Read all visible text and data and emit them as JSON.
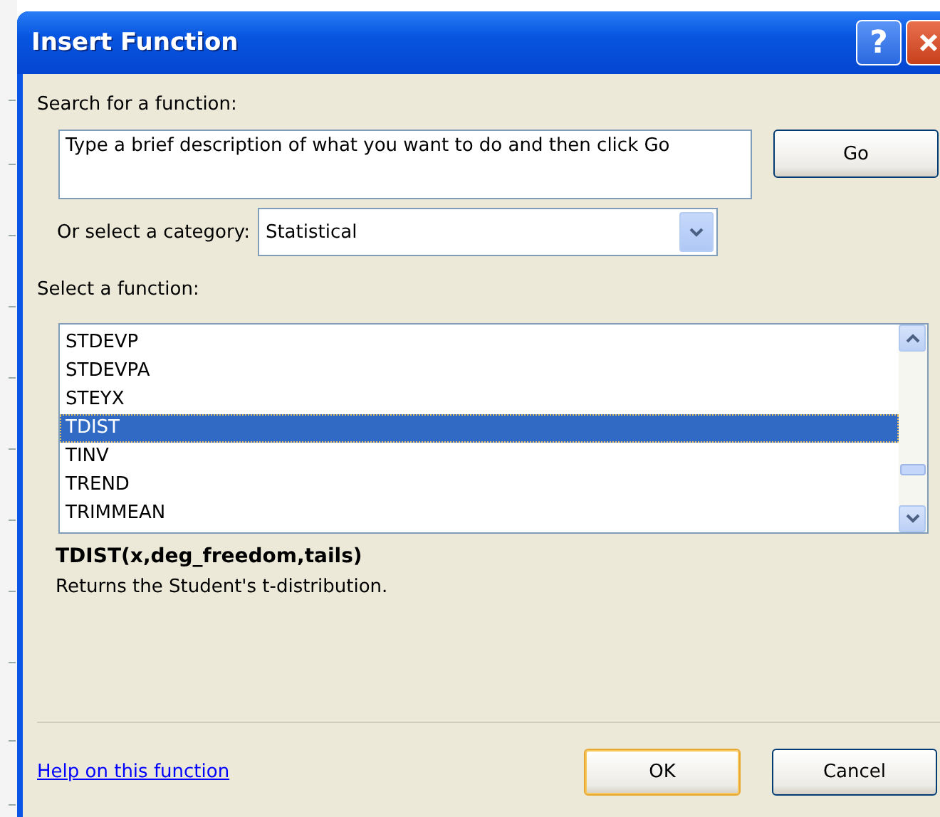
{
  "window": {
    "title": "Insert Function",
    "help_button": "?"
  },
  "search": {
    "label": "Search for a function:",
    "value": "Type a brief description of what you want to do and then click Go",
    "go_button": "Go"
  },
  "category": {
    "label": "Or select a category:",
    "value": "Statistical"
  },
  "functions": {
    "label": "Select a function:",
    "items": [
      {
        "name": "STDEVP",
        "selected": false
      },
      {
        "name": "STDEVPA",
        "selected": false
      },
      {
        "name": "STEYX",
        "selected": false
      },
      {
        "name": "TDIST",
        "selected": true
      },
      {
        "name": "TINV",
        "selected": false
      },
      {
        "name": "TREND",
        "selected": false
      },
      {
        "name": "TRIMMEAN",
        "selected": false
      }
    ]
  },
  "signature": "TDIST(x,deg_freedom,tails)",
  "description": "Returns the Student's t-distribution.",
  "help_link": "Help on this function",
  "buttons": [
    {
      "label": "OK",
      "default": true
    },
    {
      "label": "Cancel",
      "default": false
    }
  ]
}
